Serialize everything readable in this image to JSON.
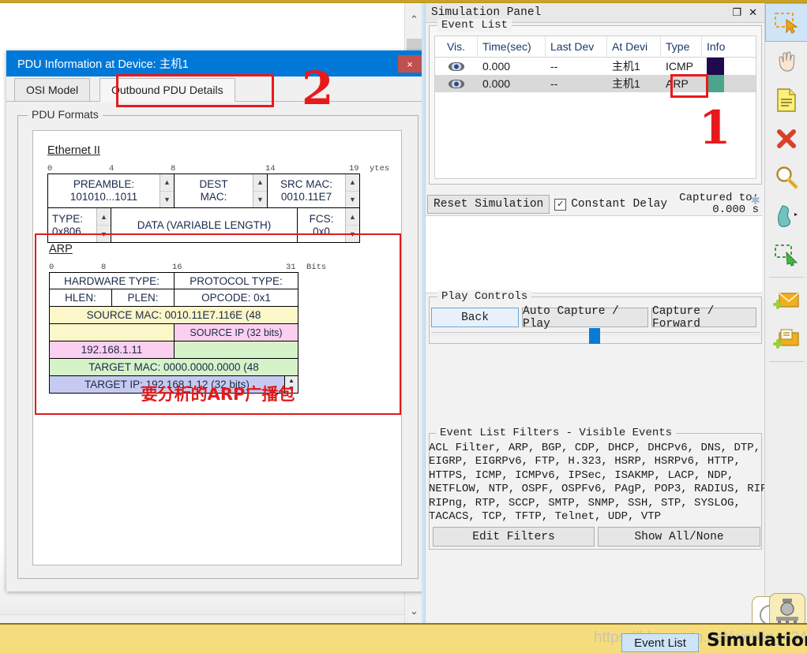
{
  "workspace": {
    "scroll_up": "⌃",
    "scroll_down": "⌄",
    "scroll_right": "›"
  },
  "dialog": {
    "title": "PDU Information at Device: 主机1",
    "close_label": "×",
    "tabs": [
      {
        "label": "OSI Model",
        "selected": false
      },
      {
        "label": "Outbound PDU Details",
        "selected": true
      }
    ],
    "group_label": "PDU Formats",
    "ethernet": {
      "heading": "Ethernet II",
      "ruler_ticks": [
        "0",
        "4",
        "8",
        "14",
        "19"
      ],
      "unit_label": "ytes",
      "row1": [
        {
          "line1": "PREAMBLE:",
          "line2": "101010...1011",
          "spinner": true
        },
        {
          "line1": "DEST",
          "line2": "MAC:",
          "spinner": true
        },
        {
          "line1": "SRC MAC:",
          "line2": "0010.11E7",
          "spinner": true
        }
      ],
      "row2": [
        {
          "line1": "TYPE:",
          "line2": "0x806",
          "spinner": true
        },
        {
          "line1": "DATA (VARIABLE LENGTH)",
          "line2": "",
          "spinner": false
        },
        {
          "line1": "FCS:",
          "line2": "0x0",
          "spinner": true
        }
      ]
    },
    "arp": {
      "heading": "ARP",
      "ruler_ticks": [
        "0",
        "8",
        "16",
        "31"
      ],
      "unit_label": "Bits",
      "row_hw": [
        "HARDWARE TYPE:",
        "PROTOCOL TYPE:"
      ],
      "row_len": [
        "HLEN:",
        "PLEN:",
        "OPCODE: 0x1"
      ],
      "source_mac": "SOURCE MAC: 0010.11E7.116E (48",
      "source_ip_label": "SOURCE IP (32 bits)",
      "source_ip_value": "192.168.1.11",
      "target_mac": "TARGET MAC: 0000.0000.0000 (48",
      "target_ip": "TARGET IP: 192.168.1.12 (32 bits)",
      "annotation_cn": "要分析的ARP广播包",
      "colors": {
        "source_mac_bg": "#fbf7c8",
        "source_ip_bg": "#fbcfef",
        "target_mac_bg": "#d6f2c8",
        "target_ip_bg": "#c7caf0"
      }
    }
  },
  "annotations": {
    "marker_1": "1",
    "marker_2": "2",
    "color": "#e8191d"
  },
  "simulation_panel": {
    "title": "Simulation Panel",
    "restore_icon": "❐",
    "close_icon": "✕",
    "event_list": {
      "group_label": "Event List",
      "columns": [
        "Vis.",
        "Time(sec)",
        "Last Dev",
        "At Devi",
        "Type",
        "Info"
      ],
      "rows": [
        {
          "vis": "eye-icon",
          "time": "0.000",
          "last_dev": "--",
          "at_device": "主机1",
          "type": "ICMP",
          "color": "#1f0a4d",
          "selected": false
        },
        {
          "vis": "eye-icon",
          "time": "0.000",
          "last_dev": "--",
          "at_device": "主机1",
          "type": "ARP",
          "color": "#4ba58c",
          "selected": true
        }
      ]
    },
    "reset_button": "Reset Simulation",
    "constant_delay": {
      "label": "Constant Delay",
      "checked": true,
      "mark": "✓"
    },
    "captured_to": {
      "line1": "Captured to:",
      "line2": "0.000 s",
      "asterisk": "✱"
    },
    "play_controls": {
      "group_label": "Play Controls",
      "back": "Back",
      "auto_capture": "Auto Capture / Play",
      "capture_forward": "Capture / Forward"
    },
    "filters": {
      "group_label": "Event List Filters - Visible Events",
      "text": "ACL Filter, ARP, BGP, CDP, DHCP, DHCPv6, DNS, DTP,\nEIGRP, EIGRPv6, FTP, H.323, HSRP, HSRPv6, HTTP,\nHTTPS, ICMP, ICMPv6, IPSec, ISAKMP, LACP, NDP,\nNETFLOW, NTP, OSPF, OSPFv6, PAgP, POP3, RADIUS, RIP,\nRIPng, RTP, SCCP, SMTP, SNMP, SSH, STP, SYSLOG,\nTACACS, TCP, TFTP, Telnet, UDP, VTP",
      "edit_button": "Edit Filters",
      "show_button": "Show All/None"
    }
  },
  "right_toolbar": {
    "items": [
      {
        "name": "select-tool",
        "active": true
      },
      {
        "name": "hand-move-tool",
        "active": false
      },
      {
        "name": "note-tool",
        "active": false
      },
      {
        "name": "delete-tool",
        "active": false
      },
      {
        "name": "inspect-magnifier-tool",
        "active": false
      },
      {
        "name": "draw-shape-tool",
        "active": false
      },
      {
        "name": "resize-shape-tool",
        "active": false
      },
      {
        "name": "add-simple-pdu-tool",
        "active": false
      },
      {
        "name": "add-complex-pdu-tool",
        "active": false
      }
    ]
  },
  "status_bar": {
    "watermark": "https://blog.csdn.net/weixin_43400595",
    "event_list_tag": "Event List",
    "mode_label": "Simulation"
  }
}
